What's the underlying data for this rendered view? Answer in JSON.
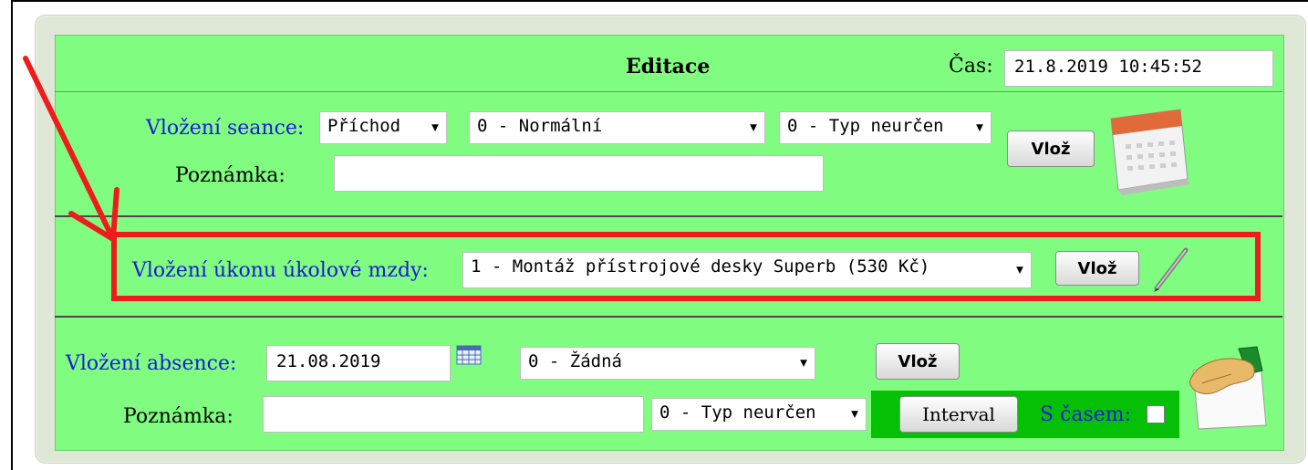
{
  "header": {
    "title": "Editace",
    "time_label": "Čas:",
    "time_value": "21.8.2019 10:45:52"
  },
  "seance": {
    "label": "Vložení seance:",
    "type_select": "Příchod",
    "mode_select": "0 - Normální",
    "kind_select": "0 - Typ neurčen",
    "insert_button": "Vlož",
    "note_label": "Poznámka:",
    "note_value": ""
  },
  "piecework": {
    "label": "Vložení úkonu úkolové mzdy:",
    "task_select": "1 - Montáž přístrojové desky Superb (530 Kč)",
    "insert_button": "Vlož"
  },
  "absence": {
    "label": "Vložení absence:",
    "date_value": "21.08.2019",
    "absence_select": "0 - Žádná",
    "insert_button": "Vlož",
    "note_label": "Poznámka:",
    "note_value": "",
    "kind_select": "0 - Typ neurčen",
    "interval_button": "Interval",
    "with_time_label": "S časem:",
    "with_time_checked": false
  },
  "colors": {
    "panel": "#80fd80",
    "label_blue": "#1a1ad6",
    "highlight_red": "#ee1c1c",
    "interval_bar": "#06c006"
  },
  "icons": [
    "calendar-icon",
    "pen-icon",
    "date-picker-icon",
    "hand-note-icon",
    "annotation-arrow"
  ]
}
